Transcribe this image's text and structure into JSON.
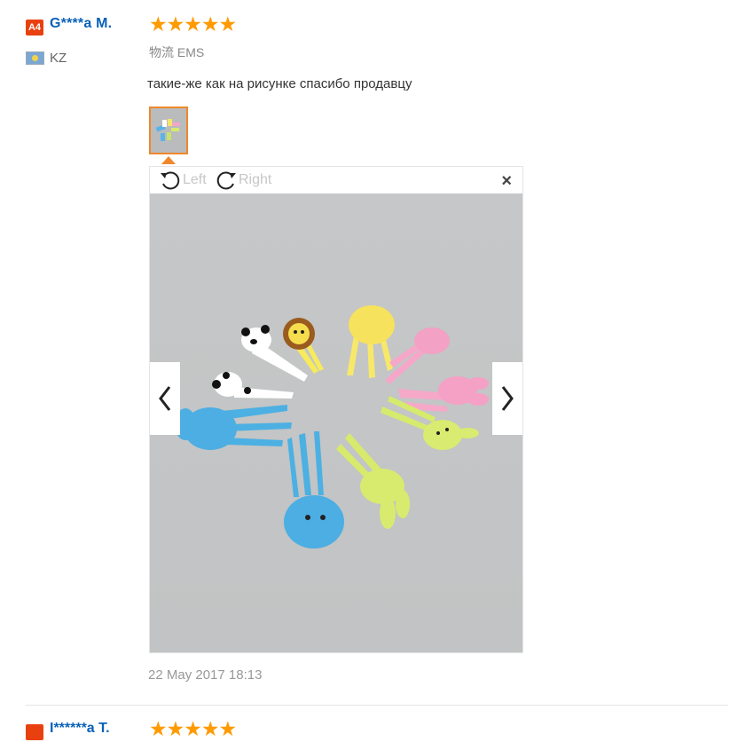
{
  "reviewer": {
    "level_badge": "A4",
    "name": "G****a M.",
    "country": "KZ",
    "flag_icon": "flag-kz-icon"
  },
  "review": {
    "stars_text": "★★★★★",
    "rating": 5,
    "shipping": "物流 EMS",
    "text": "такие-же как на рисунке спасибо продавцу",
    "date": "22 May 2017 18:13"
  },
  "viewer": {
    "rotate_left_label": "Left",
    "rotate_right_label": "Right",
    "close_label": "×",
    "prev_icon": "chevron-left-icon",
    "next_icon": "chevron-right-icon"
  },
  "next_review": {
    "name": "I******a T.",
    "stars_text": "★★★★★"
  },
  "colors": {
    "accent": "#f0882b",
    "name": "#0a61b9",
    "badge": "#e8410f",
    "stars": "#ff9a00"
  }
}
